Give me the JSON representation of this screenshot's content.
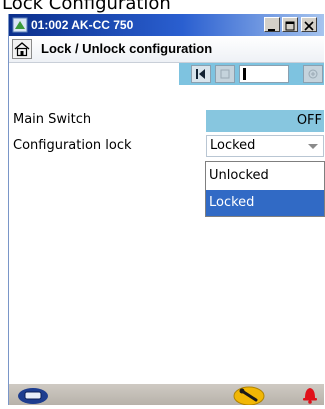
{
  "page_caption": "Lock Configuration",
  "window": {
    "title": "01:002 AK-CC 750",
    "minimize_label": "_",
    "maximize_label": "□",
    "close_label": "×"
  },
  "header": {
    "title": "Lock / Unlock configuration"
  },
  "nav": {
    "first_icon": "first-page-icon",
    "prev_icon": "previous-icon",
    "indicator_icon": "page-indicator-icon",
    "next_icon": "next-icon"
  },
  "fields": {
    "main_switch": {
      "label": "Main Switch",
      "value": "OFF"
    },
    "config_lock": {
      "label": "Configuration lock",
      "value": "Locked",
      "options": [
        "Unlocked",
        "Locked"
      ],
      "selected_index": 1
    }
  },
  "statusbar": {
    "left_icon": "device-icon",
    "center_icon": "wrench-icon",
    "right_icon": "alarm-bell-icon"
  },
  "colors": {
    "title_gradient_start": "#0b2f8c",
    "field_highlight": "#87c6df",
    "selection": "#316ac5",
    "alarm": "#e0101a",
    "wrench_badge": "#f2b705"
  }
}
